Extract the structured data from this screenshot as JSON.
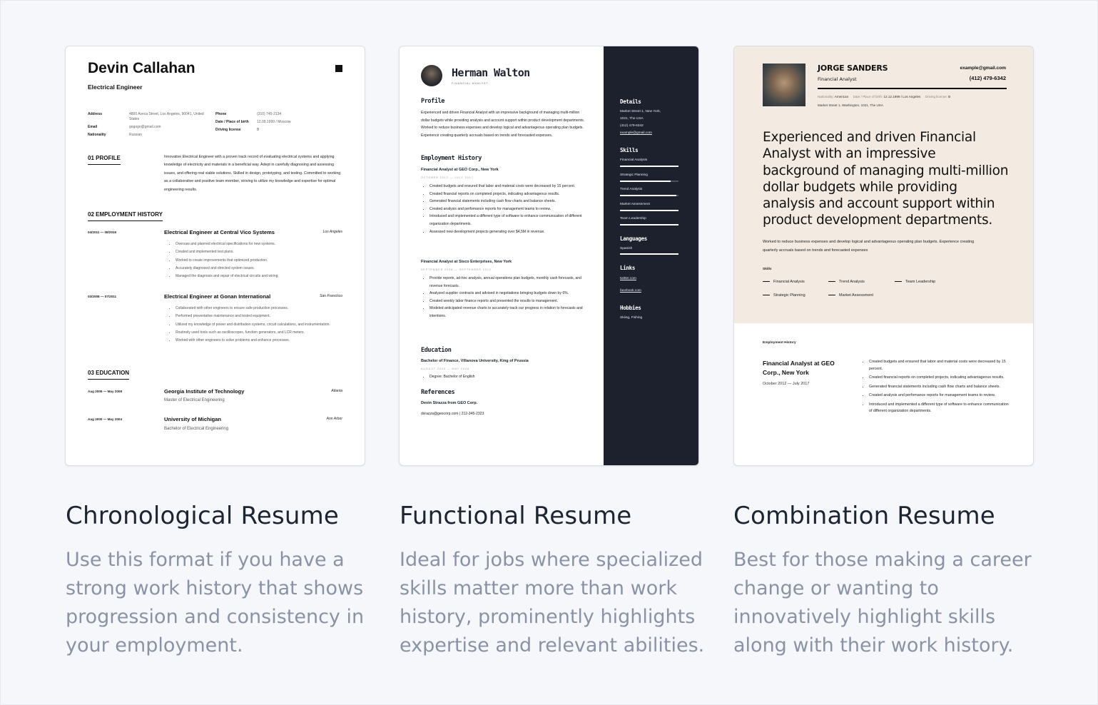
{
  "cards": [
    {
      "heading": "Chronological Resume",
      "description": "Use this format if you have a strong work history that shows progression and consistency in your employment.",
      "resume": {
        "name": "Devin Callahan",
        "job_title": "Electrical Engineer",
        "info": {
          "address_label": "Address",
          "address": "4800 Aveca Street, Los Angeles, 90041, United States",
          "email_label": "Email",
          "email": "gogogo@gmail.com",
          "nationality_label": "Nationality",
          "nationality": "Russian",
          "phone_label": "Phone",
          "phone": "(310) 745-2134",
          "dob_label": "Date / Place of birth",
          "dob": "12.09.1999 / Moscow",
          "license_label": "Driving license",
          "license": "B"
        },
        "profile_heading": "01  PROFILE",
        "profile_text": "Innovative Electrical Engineer with a proven track record of evaluating electrical systems and applying knowledge of electricity and materials in a beneficial way. Adept in carefully diagnosing and assessing issues, and offering real viable solutions. Skilled in design, prototyping, and testing. Committed to working as a collaborative and positive team member, striving to utilize my knowledge and expertise for optimal engineering results.",
        "employment_heading": "02  EMPLOYMENT HISTORY",
        "jobs": [
          {
            "dates": "04/2011 — 08/2019",
            "role": "Electrical Engineer at  Central Vico Systems",
            "location": "Los Angeles",
            "bullets": [
              "Oversaw and planned electrical specifications for new systems.",
              "Created and implemented test plans.",
              "Worked to create improvements that optimized production.",
              "Accurately diagnosed and directed system issues.",
              "Managed the diagnosis and repair of electrical circuits and wiring."
            ]
          },
          {
            "dates": "03/2008 — 07/2011",
            "role": "Electrical Engineer at  Gonan International",
            "location": "San Francisco",
            "bullets": [
              "Collaborated with other engineers to ensure safe production processes.",
              "Performed preventative maintenance and tested equipment.",
              "Utilized my knowledge of power and distribution systems, circuit calculations, and instrumentation.",
              "Routinely used tools such as oscilloscopes, function generators, and LCR meters.",
              "Worked with other engineers to solve problems and enhance processes."
            ]
          }
        ],
        "education_heading": "03  EDUCATION",
        "education": [
          {
            "dates": "Aug 2005 — May 2008",
            "school": "Georgia Institute of Technology",
            "location": "Atlanta",
            "degree": "Master of Electrical Engineering"
          },
          {
            "dates": "Aug 2000 — May 2004",
            "school": "University of Michigan",
            "location": "Ann Arbor",
            "degree": "Bachelor of Electrical Engineering"
          }
        ]
      }
    },
    {
      "heading": "Functional Resume",
      "description": "Ideal for jobs where specialized skills matter more than work history, prominently highlights expertise and relevant abilities.",
      "resume": {
        "name": "Herman Walton",
        "job_title": "FINANCIAL ANALYST",
        "profile_heading": "Profile",
        "profile_text": "Experienced and driven Financial Analyst with an impressive background of managing multi-million dollar budgets while providing analysis and account support within product development departments. Worked to reduce business expenses and develop logical and advantageous operating plan budgets. Experience creating quarterly accruals based on trends and forecasted expenses.",
        "employment_heading": "Employment History",
        "jobs": [
          {
            "role": "Financial Analyst at GEO Corp., New York",
            "dates": "OCTOBER 2012 — JULY 2017",
            "bullets": [
              "Created budgets and ensured that labor and material costs were decreased by 15 percent.",
              "Created financial reports on completed projects, indicating advantageous results.",
              "Generated financial statements including cash flow charts and balance sheets.",
              "Created analysis and perfomance reports for management teams to review.",
              "Introduced and implemented a different type of software to enhance communication of different organization departments.",
              "Assessed new development projects generating over $4,5M in revenue."
            ]
          },
          {
            "role": "Financial Analyst at Sisco Enterprises, New York",
            "dates": "SEPTEMBER 2008 — SEPTEMBER 2012",
            "bullets": [
              "Provide reports, ad-hoc analysis, annual operations plan budgets, monthly cash forecasts, and revenue forecasts.",
              "Analyzed supplier contracts and advised in negotiations bringing budgets down by 6%.",
              "Created weekly labor finance reports and presented the results to management.",
              "Modeled anticipated revenue charts to accurately track our progress in relation to forecasts and intentions."
            ]
          }
        ],
        "education_heading": "Education",
        "education_school": "Bachelor of Finance, Villanova University, King of Prussia",
        "education_dates": "AUGUST 2005 — MAY 2008",
        "education_bullet": "Degree: Bachelor of English",
        "references_heading": "References",
        "reference_name": "Devin Strazza from GEO Corp.",
        "reference_contact": "dsrazza@geocorp.com  |  212-345-2323",
        "sidebar": {
          "details_heading": "Details",
          "address_line1": "Market Street 1, New York,",
          "address_line2": "1021, The USA",
          "phone": "(412) 479-6342",
          "email": "example@gmail.com",
          "skills_heading": "Skills",
          "skills": [
            {
              "name": "Financial Analysis",
              "level": 1.0
            },
            {
              "name": "Strategic Planning",
              "level": 0.86
            },
            {
              "name": "Trend Analysis",
              "level": 0.96
            },
            {
              "name": "Market Assessment",
              "level": 1.0
            },
            {
              "name": "Team Leadership",
              "level": 1.0
            }
          ],
          "languages_heading": "Languages",
          "language": {
            "name": "Spanish",
            "level": 1.0
          },
          "links_heading": "Links",
          "links": [
            "twitter.com",
            "facebook.com"
          ],
          "hobbies_heading": "Hobbies",
          "hobbies": "Skiing, Fishing"
        }
      }
    },
    {
      "heading": "Combination Resume",
      "description": "Best for those making a career change or wanting to innovatively highlight skills along with their work history.",
      "resume": {
        "name": "JORGE SANDERS",
        "job_title": "Financial Analyst",
        "email": "example@gmail.com",
        "phone": "(412) 479-6342",
        "nationality_label": "Nationality:",
        "nationality": "American",
        "dob_label": "Date / Place of birth:",
        "dob": "12.12.1999 / Los Angeles",
        "license_label": "Driving license:",
        "license": "B",
        "address": "Market Street 1, Washington, 1021, The USA",
        "summary": "Experienced and driven Financial Analyst with an impressive background of managing multi-million dollar budgets while providing analysis and account support within product development departments.",
        "summary_small": "Worked to reduce business expenses and develop logical and advantageous operating plan budgets. Experience creating quarterly accruals based on trends and forecasted expenses",
        "skills_heading": "Skills",
        "skills": [
          "Financial Analysis",
          "Trend Analysis",
          "Team Leadership",
          "Strategic Planning",
          "Market Assessment"
        ],
        "employment_heading": "Employment History",
        "job_role": "Financial Analyst at GEO Corp., New York",
        "job_dates": "October 2012 — July 2017",
        "bullets": [
          "Created budgets and ensured that labor and material costs were decreased by 15 percent.",
          "Created financial reports on completed projects, indicating advantageous results.",
          "Generated financial statements including cash flow charts and balance sheets.",
          "Created analysis and perfomance reports for management teams to review.",
          "Introduced and implemented a different type of software to enhance communication of different organization departments."
        ]
      }
    }
  ]
}
